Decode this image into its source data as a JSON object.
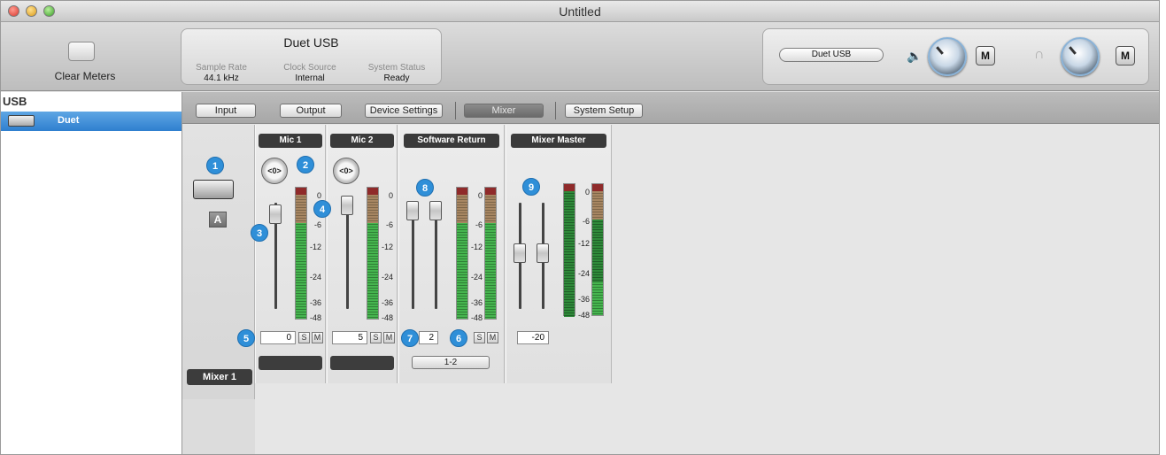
{
  "window": {
    "title": "Untitled"
  },
  "toolbar": {
    "clear_meters_label": "Clear Meters",
    "device": {
      "name": "Duet USB",
      "sample_rate_label": "Sample Rate",
      "sample_rate_value": "44.1 kHz",
      "clock_source_label": "Clock Source",
      "clock_source_value": "Internal",
      "system_status_label": "System Status",
      "system_status_value": "Ready"
    },
    "output_device_select": "Duet USB",
    "speaker_mute_label": "M",
    "headphone_mute_label": "M"
  },
  "sidebar": {
    "header": "USB",
    "items": [
      {
        "label": "Duet"
      }
    ]
  },
  "tabs": {
    "input": "Input",
    "output": "Output",
    "device_settings": "Device Settings",
    "mixer": "Mixer",
    "system_setup": "System Setup",
    "active": "mixer"
  },
  "mixer": {
    "name": "Mixer 1",
    "channel_badge": "A",
    "meter_scale": [
      "0",
      "-6",
      "-12",
      "-24",
      "-36",
      "-48"
    ],
    "channels": [
      {
        "title": "Mic 1",
        "pan": "<0>",
        "value": "0",
        "solo": "S",
        "mute": "M"
      },
      {
        "title": "Mic 2",
        "pan": "<0>",
        "value": "5",
        "solo": "S",
        "mute": "M"
      },
      {
        "title": "Software Return",
        "value": "2",
        "solo": "S",
        "mute": "M",
        "route": "1-2"
      },
      {
        "title": "Mixer Master",
        "value": "-20"
      }
    ],
    "callouts": [
      "1",
      "2",
      "3",
      "4",
      "5",
      "6",
      "7",
      "8",
      "9"
    ]
  }
}
